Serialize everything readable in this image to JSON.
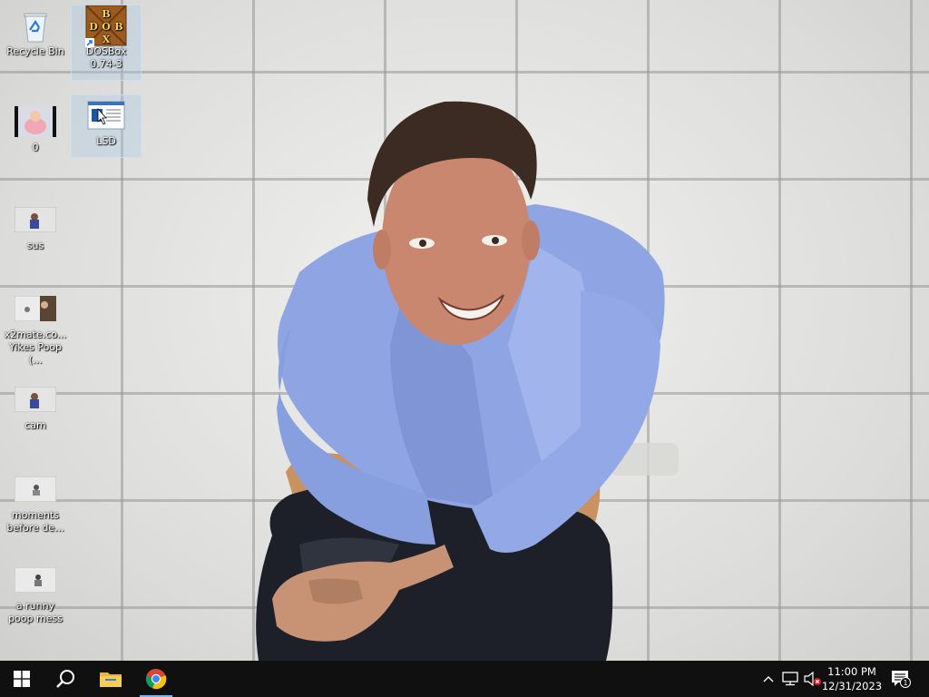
{
  "desktop": {
    "icons": [
      {
        "label": "Recycle Bin"
      },
      {
        "label": "DOSBox 0.74-3"
      },
      {
        "label": "0"
      },
      {
        "label": "LSD"
      },
      {
        "label": "sus"
      },
      {
        "label": "x2mate.co... Yikes Poop (..."
      },
      {
        "label": "cam"
      },
      {
        "label": "moments before de..."
      },
      {
        "label": "a runny poop mess"
      }
    ],
    "dosbox_logo_text": [
      "B",
      "O",
      "D",
      "O",
      "S",
      "B",
      "O",
      "X"
    ]
  },
  "taskbar": {
    "time": "11:00 PM",
    "date": "12/31/2023",
    "notification_count": "1",
    "icons": [
      "windows-start-icon",
      "search-icon",
      "file-explorer-icon",
      "chrome-icon"
    ],
    "tray_icons": [
      "chevron-up-icon",
      "network-icon",
      "volume-muted-icon",
      "action-center-icon"
    ]
  },
  "colors": {
    "taskbar_bg": "#101010",
    "active_indicator": "#76b9ed",
    "shirt": "#8fa5e3"
  }
}
